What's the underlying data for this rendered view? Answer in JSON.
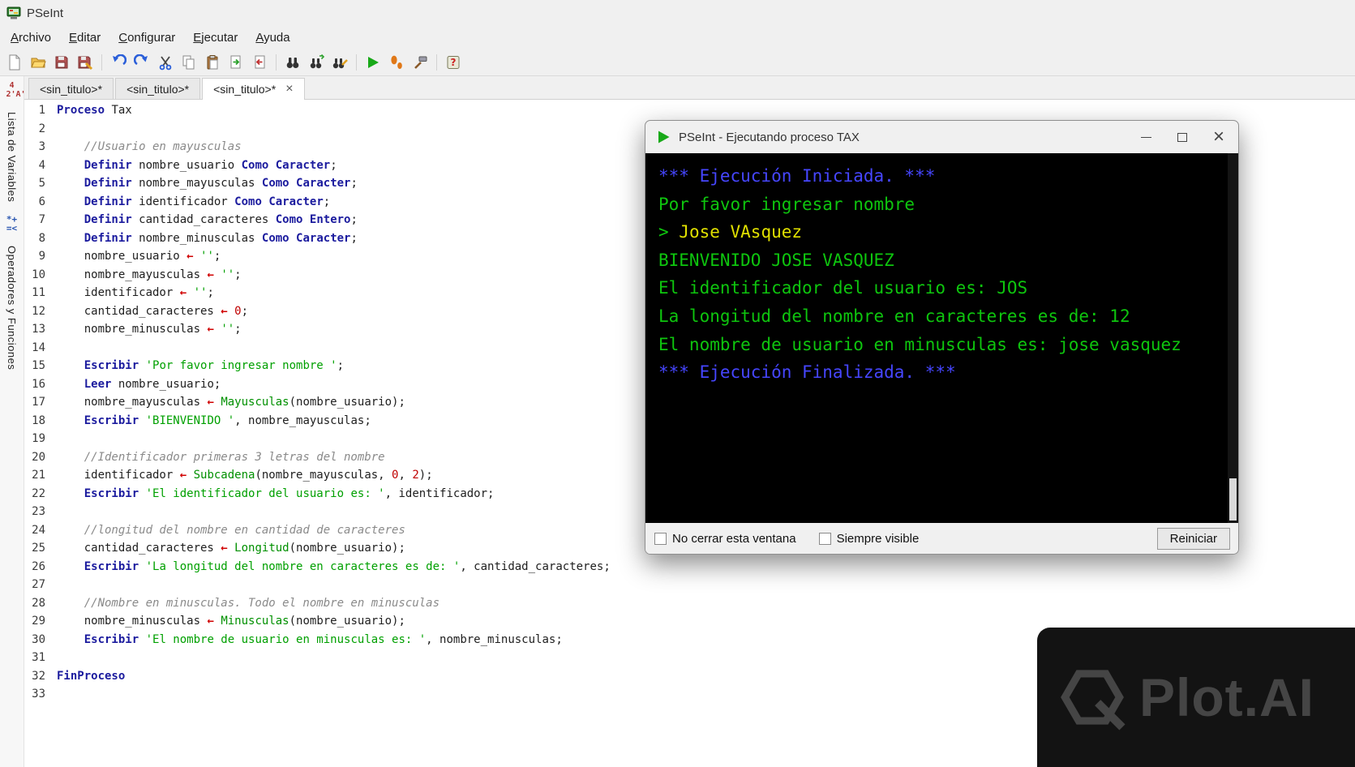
{
  "app": {
    "title": "PSeInt"
  },
  "menu_bar": {
    "items": [
      "Archivo",
      "Editar",
      "Configurar",
      "Ejecutar",
      "Ayuda"
    ]
  },
  "toolbar": {
    "icons": [
      "new-file",
      "open-file",
      "save-file",
      "save-as",
      "undo",
      "redo",
      "cut",
      "copy",
      "paste",
      "comment",
      "uncomment",
      "find",
      "find-next",
      "replace",
      "run",
      "step-execution",
      "flowchart-tools",
      "help"
    ]
  },
  "tab_bar": {
    "close_glyph": "×",
    "tabs": [
      {
        "label": "<sin_titulo>*",
        "active": false
      },
      {
        "label": "<sin_titulo>*",
        "active": false
      },
      {
        "label": "<sin_titulo>*",
        "active": true
      }
    ]
  },
  "side_panels": [
    {
      "icon_glyphs": "42'A'¿?",
      "label": "Lista de Variables"
    },
    {
      "icon_glyphs": "*+=<",
      "label": "Operadores y Funciones"
    }
  ],
  "editor": {
    "lines": [
      {
        "num": 1,
        "segs": [
          [
            "k",
            "Proceso"
          ],
          [
            "p",
            " Tax"
          ]
        ]
      },
      {
        "num": 2,
        "segs": []
      },
      {
        "num": 3,
        "segs": [
          [
            "c",
            "    //Usuario en mayusculas"
          ]
        ]
      },
      {
        "num": 4,
        "segs": [
          [
            "p",
            "    "
          ],
          [
            "k",
            "Definir"
          ],
          [
            "p",
            " nombre_usuario "
          ],
          [
            "k",
            "Como"
          ],
          [
            "p",
            " "
          ],
          [
            "k",
            "Caracter"
          ],
          [
            "p",
            ";"
          ]
        ]
      },
      {
        "num": 5,
        "segs": [
          [
            "p",
            "    "
          ],
          [
            "k",
            "Definir"
          ],
          [
            "p",
            " nombre_mayusculas "
          ],
          [
            "k",
            "Como"
          ],
          [
            "p",
            " "
          ],
          [
            "k",
            "Caracter"
          ],
          [
            "p",
            ";"
          ]
        ]
      },
      {
        "num": 6,
        "segs": [
          [
            "p",
            "    "
          ],
          [
            "k",
            "Definir"
          ],
          [
            "p",
            " identificador "
          ],
          [
            "k",
            "Como"
          ],
          [
            "p",
            " "
          ],
          [
            "k",
            "Caracter"
          ],
          [
            "p",
            ";"
          ]
        ]
      },
      {
        "num": 7,
        "segs": [
          [
            "p",
            "    "
          ],
          [
            "k",
            "Definir"
          ],
          [
            "p",
            " cantidad_caracteres "
          ],
          [
            "k",
            "Como"
          ],
          [
            "p",
            " "
          ],
          [
            "k",
            "Entero"
          ],
          [
            "p",
            ";"
          ]
        ]
      },
      {
        "num": 8,
        "segs": [
          [
            "p",
            "    "
          ],
          [
            "k",
            "Definir"
          ],
          [
            "p",
            " nombre_minusculas "
          ],
          [
            "k",
            "Como"
          ],
          [
            "p",
            " "
          ],
          [
            "k",
            "Caracter"
          ],
          [
            "p",
            ";"
          ]
        ]
      },
      {
        "num": 9,
        "segs": [
          [
            "p",
            "    nombre_usuario "
          ],
          [
            "o",
            "←"
          ],
          [
            "p",
            " "
          ],
          [
            "s",
            "''"
          ],
          [
            "p",
            ";"
          ]
        ]
      },
      {
        "num": 10,
        "segs": [
          [
            "p",
            "    nombre_mayusculas "
          ],
          [
            "o",
            "←"
          ],
          [
            "p",
            " "
          ],
          [
            "s",
            "''"
          ],
          [
            "p",
            ";"
          ]
        ]
      },
      {
        "num": 11,
        "segs": [
          [
            "p",
            "    identificador "
          ],
          [
            "o",
            "←"
          ],
          [
            "p",
            " "
          ],
          [
            "s",
            "''"
          ],
          [
            "p",
            ";"
          ]
        ]
      },
      {
        "num": 12,
        "segs": [
          [
            "p",
            "    cantidad_caracteres "
          ],
          [
            "o",
            "←"
          ],
          [
            "p",
            " "
          ],
          [
            "n",
            "0"
          ],
          [
            "p",
            ";"
          ]
        ]
      },
      {
        "num": 13,
        "segs": [
          [
            "p",
            "    nombre_minusculas "
          ],
          [
            "o",
            "←"
          ],
          [
            "p",
            " "
          ],
          [
            "s",
            "''"
          ],
          [
            "p",
            ";"
          ]
        ]
      },
      {
        "num": 14,
        "segs": []
      },
      {
        "num": 15,
        "segs": [
          [
            "p",
            "    "
          ],
          [
            "k",
            "Escribir"
          ],
          [
            "p",
            " "
          ],
          [
            "s",
            "'Por favor ingresar nombre '"
          ],
          [
            "p",
            ";"
          ]
        ]
      },
      {
        "num": 16,
        "segs": [
          [
            "p",
            "    "
          ],
          [
            "k",
            "Leer"
          ],
          [
            "p",
            " nombre_usuario;"
          ]
        ]
      },
      {
        "num": 17,
        "segs": [
          [
            "p",
            "    nombre_mayusculas "
          ],
          [
            "o",
            "←"
          ],
          [
            "p",
            " "
          ],
          [
            "f",
            "Mayusculas"
          ],
          [
            "p",
            "(nombre_usuario);"
          ]
        ]
      },
      {
        "num": 18,
        "segs": [
          [
            "p",
            "    "
          ],
          [
            "k",
            "Escribir"
          ],
          [
            "p",
            " "
          ],
          [
            "s",
            "'BIENVENIDO '"
          ],
          [
            "p",
            ", nombre_mayusculas;"
          ]
        ]
      },
      {
        "num": 19,
        "segs": []
      },
      {
        "num": 20,
        "segs": [
          [
            "c",
            "    //Identificador primeras 3 letras del nombre"
          ]
        ]
      },
      {
        "num": 21,
        "segs": [
          [
            "p",
            "    identificador "
          ],
          [
            "o",
            "←"
          ],
          [
            "p",
            " "
          ],
          [
            "f",
            "Subcadena"
          ],
          [
            "p",
            "(nombre_mayusculas, "
          ],
          [
            "n",
            "0"
          ],
          [
            "p",
            ", "
          ],
          [
            "n",
            "2"
          ],
          [
            "p",
            ");"
          ]
        ]
      },
      {
        "num": 22,
        "segs": [
          [
            "p",
            "    "
          ],
          [
            "k",
            "Escribir"
          ],
          [
            "p",
            " "
          ],
          [
            "s",
            "'El identificador del usuario es: '"
          ],
          [
            "p",
            ", identificador;"
          ]
        ]
      },
      {
        "num": 23,
        "segs": []
      },
      {
        "num": 24,
        "segs": [
          [
            "c",
            "    //longitud del nombre en cantidad de caracteres"
          ]
        ]
      },
      {
        "num": 25,
        "segs": [
          [
            "p",
            "    cantidad_caracteres "
          ],
          [
            "o",
            "←"
          ],
          [
            "p",
            " "
          ],
          [
            "f",
            "Longitud"
          ],
          [
            "p",
            "(nombre_usuario);"
          ]
        ]
      },
      {
        "num": 26,
        "segs": [
          [
            "p",
            "    "
          ],
          [
            "k",
            "Escribir"
          ],
          [
            "p",
            " "
          ],
          [
            "s",
            "'La longitud del nombre en caracteres es de: '"
          ],
          [
            "p",
            ", cantidad_caracteres;"
          ]
        ]
      },
      {
        "num": 27,
        "segs": []
      },
      {
        "num": 28,
        "segs": [
          [
            "c",
            "    //Nombre en minusculas. Todo el nombre en minusculas"
          ]
        ]
      },
      {
        "num": 29,
        "segs": [
          [
            "p",
            "    nombre_minusculas "
          ],
          [
            "o",
            "←"
          ],
          [
            "p",
            " "
          ],
          [
            "f",
            "Minusculas"
          ],
          [
            "p",
            "(nombre_usuario);"
          ]
        ]
      },
      {
        "num": 30,
        "segs": [
          [
            "p",
            "    "
          ],
          [
            "k",
            "Escribir"
          ],
          [
            "p",
            " "
          ],
          [
            "s",
            "'El nombre de usuario en minusculas es: '"
          ],
          [
            "p",
            ", nombre_minusculas;"
          ]
        ]
      },
      {
        "num": 31,
        "segs": []
      },
      {
        "num": 32,
        "segs": [
          [
            "k",
            "FinProceso"
          ]
        ]
      },
      {
        "num": 33,
        "segs": []
      }
    ]
  },
  "console_window": {
    "title": "PSeInt - Ejecutando proceso TAX",
    "terminal_lines": [
      {
        "segs": [
          [
            "info",
            "*** Ejecución Iniciada. ***"
          ]
        ]
      },
      {
        "segs": [
          [
            "out",
            "Por favor ingresar nombre"
          ]
        ]
      },
      {
        "segs": [
          [
            "out",
            "> "
          ],
          [
            "in",
            "Jose VAsquez"
          ]
        ]
      },
      {
        "segs": [
          [
            "out",
            "BIENVENIDO JOSE VASQUEZ"
          ]
        ]
      },
      {
        "segs": [
          [
            "out",
            "El identificador del usuario es: JOS"
          ]
        ]
      },
      {
        "segs": [
          [
            "out",
            "La longitud del nombre en caracteres es de: 12"
          ]
        ]
      },
      {
        "segs": [
          [
            "out",
            "El nombre de usuario en minusculas es: jose vasquez"
          ]
        ]
      },
      {
        "segs": [
          [
            "info",
            "*** Ejecución Finalizada. ***"
          ]
        ]
      }
    ],
    "footer": {
      "checkboxes": [
        {
          "label": "No cerrar esta ventana",
          "checked": false
        },
        {
          "label": "Siempre visible",
          "checked": false
        }
      ],
      "restart_button": "Reiniciar"
    }
  },
  "watermark": {
    "text": "Plot.AI"
  },
  "colors": {
    "keyword": "#1b1b9e",
    "string": "#00a000",
    "function": "#009000",
    "number": "#c00000",
    "operator": "#d00000",
    "comment": "#8a8a8a",
    "console_info": "#4646ff",
    "console_output": "#0ec50e",
    "console_input": "#e0e000",
    "run_green": "#18a918",
    "chrome": "#f0f0f0"
  }
}
